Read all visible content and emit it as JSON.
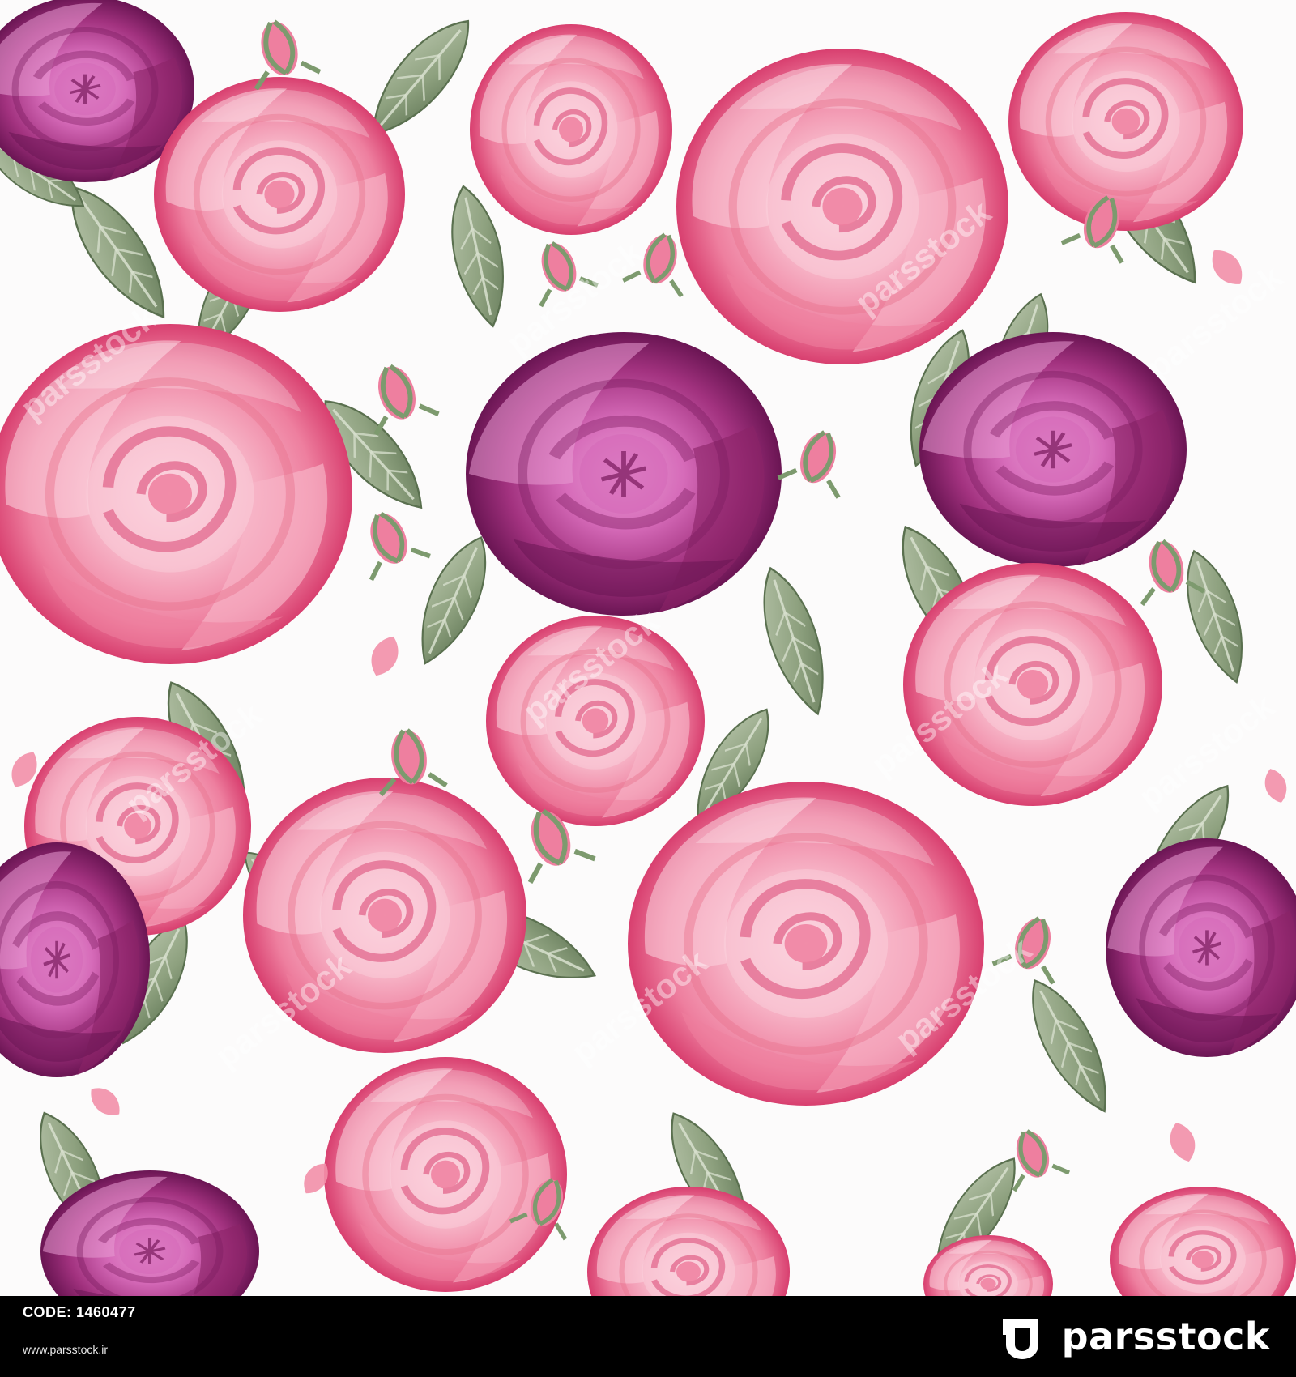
{
  "footer": {
    "code_label": "CODE:",
    "code_value": "1460477",
    "website": "www.parsstock.ir",
    "logo_text": "parsstock"
  },
  "artwork": {
    "subject": "watercolor seamless floral pattern",
    "watermark": "parsstock",
    "colors": {
      "rose_light": "#f7b6c8",
      "rose_mid": "#ee7f9f",
      "rose_deep": "#d83f6f",
      "peony_light": "#d66bb9",
      "peony_mid": "#a2327f",
      "peony_deep": "#6a1553",
      "leaf_light": "#9fb090",
      "leaf_dark": "#5f7554",
      "background": "#fcfbfb"
    }
  }
}
